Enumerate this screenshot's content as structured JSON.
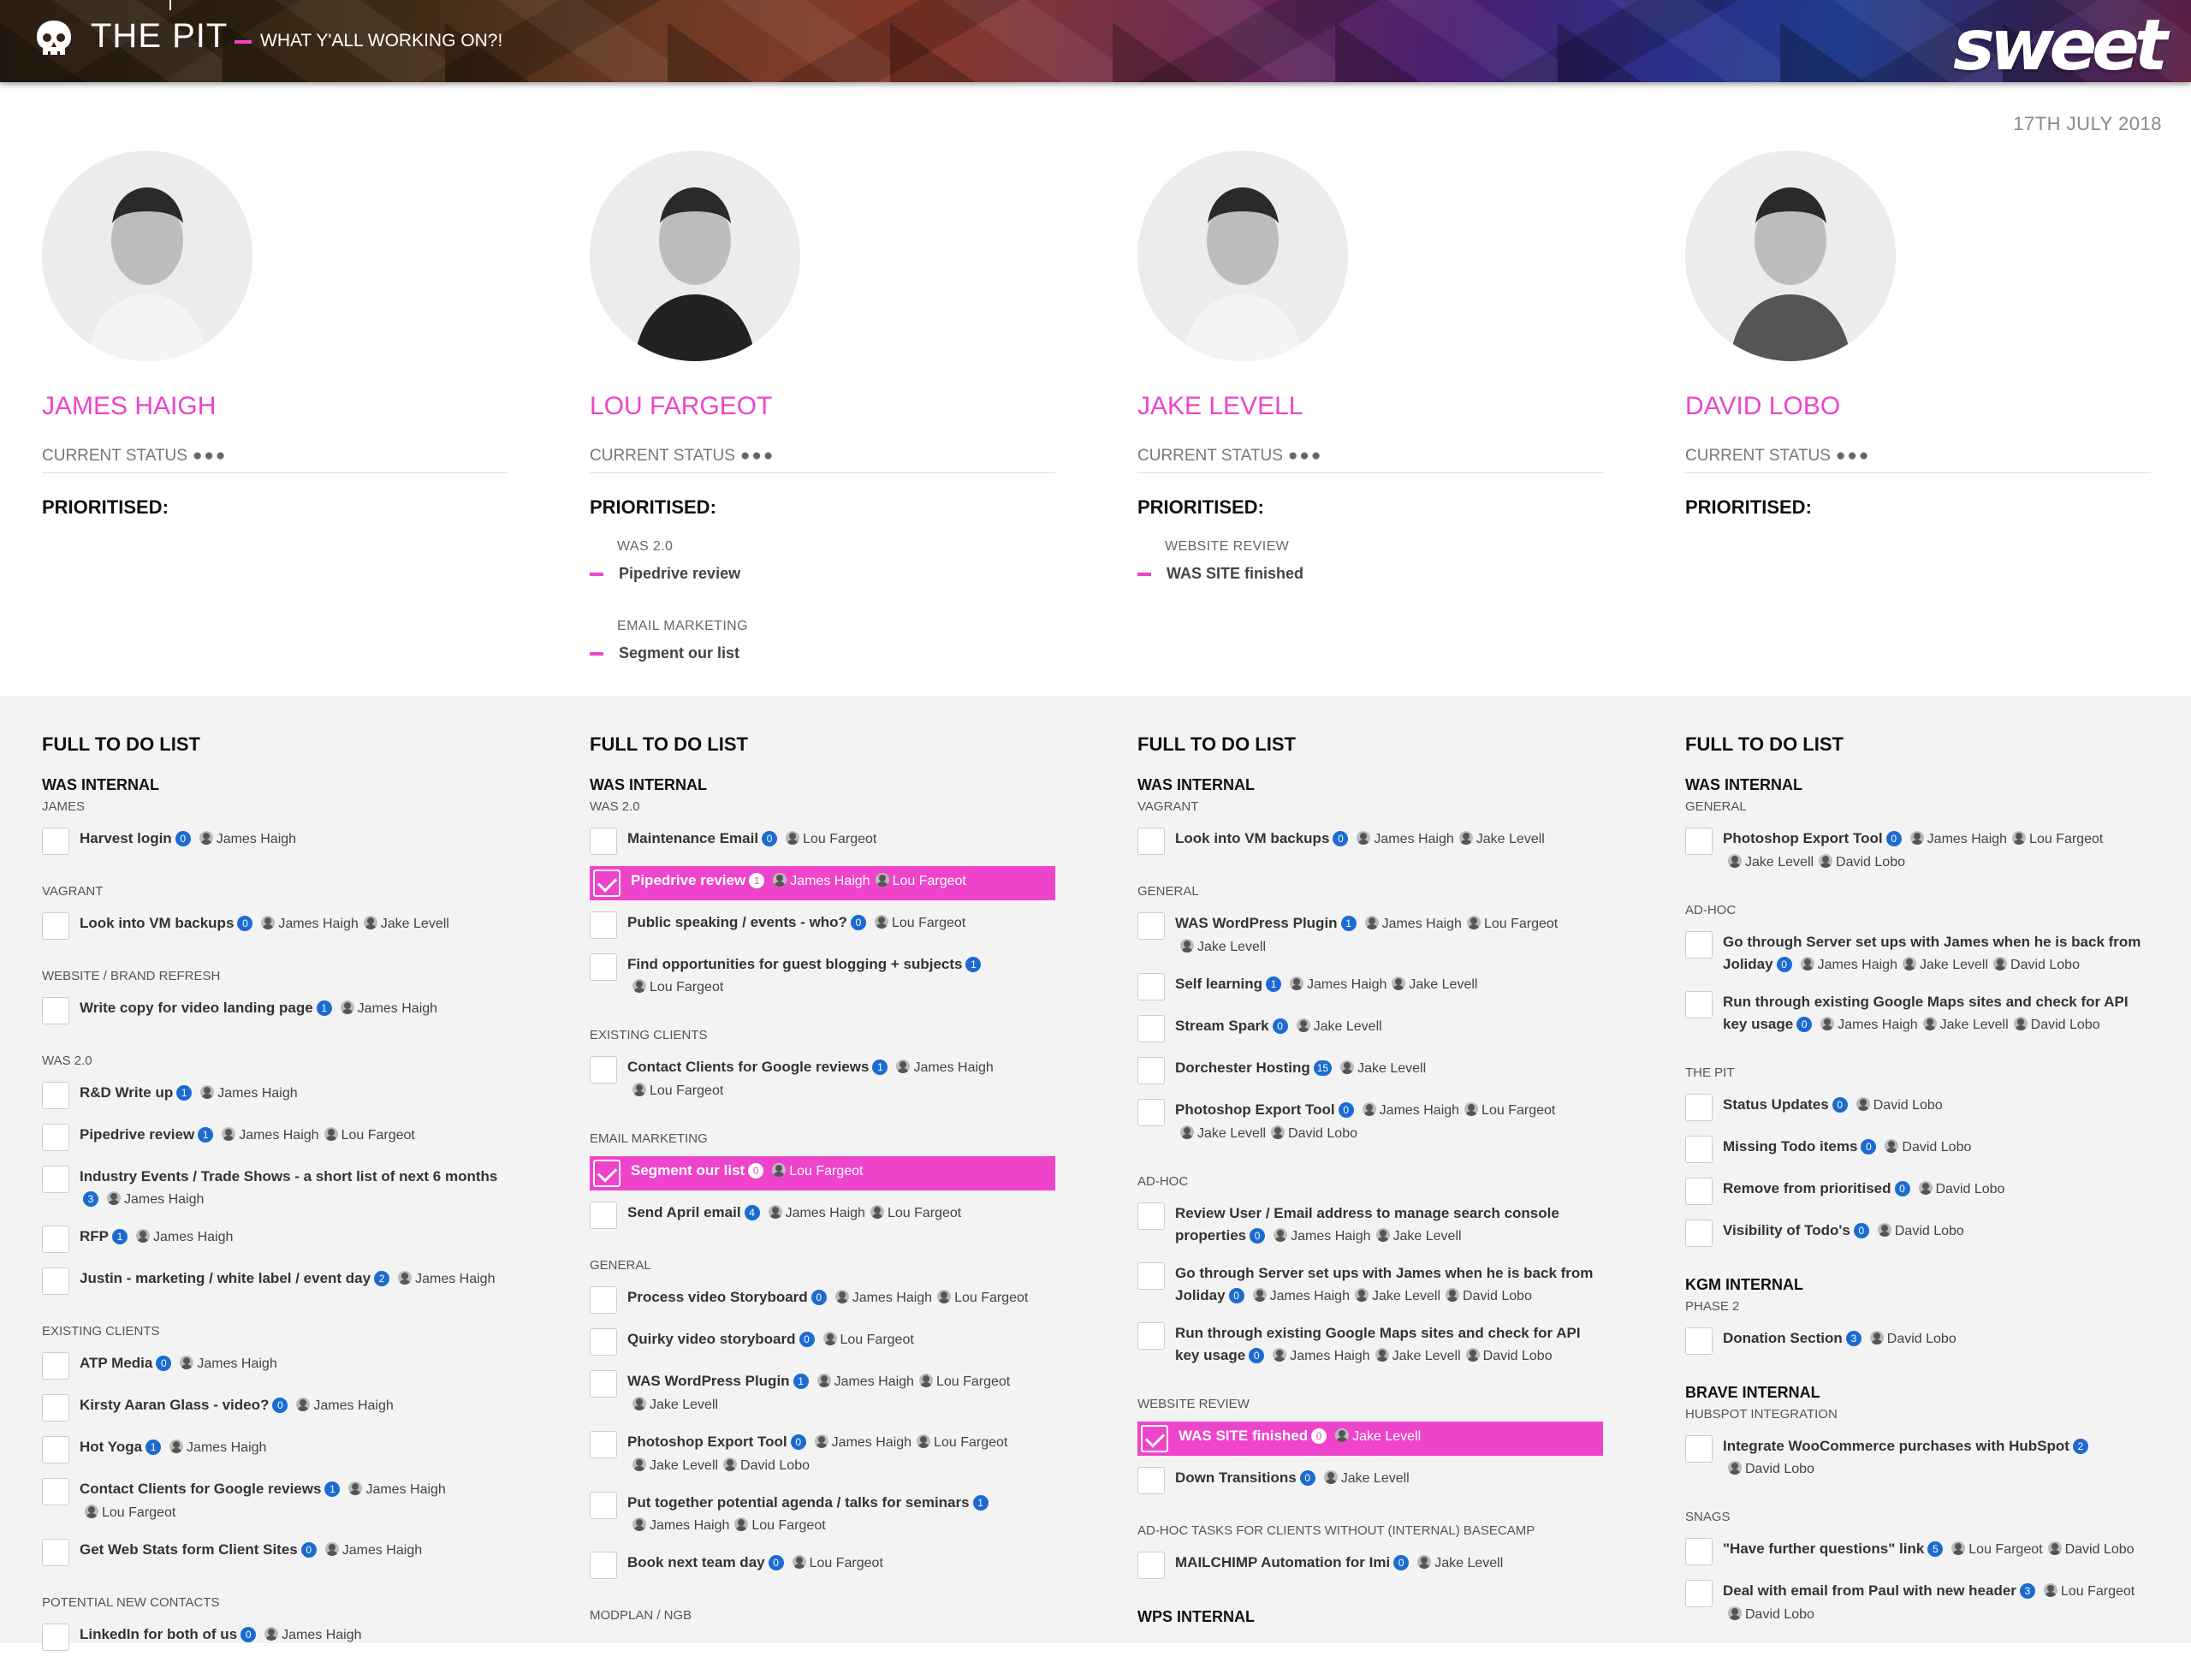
{
  "header": {
    "brand": "THE PIT",
    "tagline": "WHAT Y'ALL WORKING ON?!",
    "logo": "sweet"
  },
  "date": "17TH JULY 2018",
  "people": [
    {
      "name": "JAMES HAIGH",
      "status_label": "CURRENT STATUS",
      "status_dots": "●●●",
      "prioritised_title": "PRIORITISED:",
      "prioritised": [],
      "todo_title": "FULL TO DO LIST",
      "projects": [
        {
          "project": "WAS INTERNAL",
          "groups": [
            {
              "label": "JAMES",
              "tasks": [
                {
                  "name": "Harvest login",
                  "count": "0",
                  "assignees": [
                    "James Haigh"
                  ]
                }
              ]
            },
            {
              "label": "VAGRANT",
              "tasks": [
                {
                  "name": "Look into VM backups",
                  "count": "0",
                  "assignees": [
                    "James Haigh",
                    "Jake Levell"
                  ]
                }
              ]
            },
            {
              "label": "WEBSITE / BRAND REFRESH",
              "tasks": [
                {
                  "name": "Write copy for video landing page",
                  "count": "1",
                  "assignees": [
                    "James Haigh"
                  ]
                }
              ]
            },
            {
              "label": "WAS 2.0",
              "tasks": [
                {
                  "name": "R&D Write up",
                  "count": "1",
                  "assignees": [
                    "James Haigh"
                  ]
                },
                {
                  "name": "Pipedrive review",
                  "count": "1",
                  "assignees": [
                    "James Haigh",
                    "Lou Fargeot"
                  ]
                },
                {
                  "name": "Industry Events / Trade Shows - a short list of next 6 months",
                  "count": "3",
                  "assignees": [
                    "James Haigh"
                  ]
                },
                {
                  "name": "RFP",
                  "count": "1",
                  "assignees": [
                    "James Haigh"
                  ]
                },
                {
                  "name": "Justin - marketing / white label / event day",
                  "count": "2",
                  "assignees": [
                    "James Haigh"
                  ]
                }
              ]
            },
            {
              "label": "EXISTING CLIENTS",
              "tasks": [
                {
                  "name": "ATP Media",
                  "count": "0",
                  "assignees": [
                    "James Haigh"
                  ]
                },
                {
                  "name": "Kirsty Aaran Glass - video?",
                  "count": "0",
                  "assignees": [
                    "James Haigh"
                  ]
                },
                {
                  "name": "Hot Yoga",
                  "count": "1",
                  "assignees": [
                    "James Haigh"
                  ]
                },
                {
                  "name": "Contact Clients for Google reviews",
                  "count": "1",
                  "assignees": [
                    "James Haigh",
                    "Lou Fargeot"
                  ]
                },
                {
                  "name": "Get Web Stats form Client Sites",
                  "count": "0",
                  "assignees": [
                    "James Haigh"
                  ]
                }
              ]
            },
            {
              "label": "POTENTIAL NEW CONTACTS",
              "tasks": [
                {
                  "name": "LinkedIn for both of us",
                  "count": "0",
                  "assignees": [
                    "James Haigh"
                  ]
                }
              ]
            }
          ]
        }
      ]
    },
    {
      "name": "LOU FARGEOT",
      "status_label": "CURRENT STATUS",
      "status_dots": "●●●",
      "prioritised_title": "PRIORITISED:",
      "prioritised": [
        {
          "category": "WAS 2.0",
          "task": "Pipedrive review"
        },
        {
          "category": "EMAIL MARKETING",
          "task": "Segment our list"
        }
      ],
      "todo_title": "FULL TO DO LIST",
      "projects": [
        {
          "project": "WAS INTERNAL",
          "groups": [
            {
              "label": "WAS 2.0",
              "tasks": [
                {
                  "name": "Maintenance Email",
                  "count": "0",
                  "assignees": [
                    "Lou Fargeot"
                  ]
                },
                {
                  "name": "Pipedrive review",
                  "count": "1",
                  "assignees": [
                    "James Haigh",
                    "Lou Fargeot"
                  ],
                  "done": true
                },
                {
                  "name": "Public speaking / events - who?",
                  "count": "0",
                  "assignees": [
                    "Lou Fargeot"
                  ]
                },
                {
                  "name": "Find opportunities for guest blogging + subjects",
                  "count": "1",
                  "assignees": [
                    "Lou Fargeot"
                  ]
                }
              ]
            },
            {
              "label": "EXISTING CLIENTS",
              "tasks": [
                {
                  "name": "Contact Clients for Google reviews",
                  "count": "1",
                  "assignees": [
                    "James Haigh",
                    "Lou Fargeot"
                  ]
                }
              ]
            },
            {
              "label": "EMAIL MARKETING",
              "tasks": [
                {
                  "name": "Segment our list",
                  "count": "0",
                  "assignees": [
                    "Lou Fargeot"
                  ],
                  "done": true
                },
                {
                  "name": "Send April email",
                  "count": "4",
                  "assignees": [
                    "James Haigh",
                    "Lou Fargeot"
                  ]
                }
              ]
            },
            {
              "label": "GENERAL",
              "tasks": [
                {
                  "name": "Process video Storyboard",
                  "count": "0",
                  "assignees": [
                    "James Haigh",
                    "Lou Fargeot"
                  ]
                },
                {
                  "name": "Quirky video storyboard",
                  "count": "0",
                  "assignees": [
                    "Lou Fargeot"
                  ]
                },
                {
                  "name": "WAS WordPress Plugin",
                  "count": "1",
                  "assignees": [
                    "James Haigh",
                    "Lou Fargeot",
                    "Jake Levell"
                  ]
                },
                {
                  "name": "Photoshop Export Tool",
                  "count": "0",
                  "assignees": [
                    "James Haigh",
                    "Lou Fargeot",
                    "Jake Levell",
                    "David Lobo"
                  ]
                },
                {
                  "name": "Put together potential agenda / talks for seminars",
                  "count": "1",
                  "assignees": [
                    "James Haigh",
                    "Lou Fargeot"
                  ]
                },
                {
                  "name": "Book next team day",
                  "count": "0",
                  "assignees": [
                    "Lou Fargeot"
                  ]
                }
              ]
            },
            {
              "label": "MODPLAN / NGB",
              "tasks": []
            }
          ]
        }
      ]
    },
    {
      "name": "JAKE LEVELL",
      "status_label": "CURRENT STATUS",
      "status_dots": "●●●",
      "prioritised_title": "PRIORITISED:",
      "prioritised": [
        {
          "category": "WEBSITE REVIEW",
          "task": "WAS SITE finished"
        }
      ],
      "todo_title": "FULL TO DO LIST",
      "projects": [
        {
          "project": "WAS INTERNAL",
          "groups": [
            {
              "label": "VAGRANT",
              "tasks": [
                {
                  "name": "Look into VM backups",
                  "count": "0",
                  "assignees": [
                    "James Haigh",
                    "Jake Levell"
                  ]
                }
              ]
            },
            {
              "label": "GENERAL",
              "tasks": [
                {
                  "name": "WAS WordPress Plugin",
                  "count": "1",
                  "assignees": [
                    "James Haigh",
                    "Lou Fargeot",
                    "Jake Levell"
                  ]
                },
                {
                  "name": "Self learning",
                  "count": "1",
                  "assignees": [
                    "James Haigh",
                    "Jake Levell"
                  ]
                },
                {
                  "name": "Stream Spark",
                  "count": "0",
                  "assignees": [
                    "Jake Levell"
                  ]
                },
                {
                  "name": "Dorchester Hosting",
                  "count": "15",
                  "assignees": [
                    "Jake Levell"
                  ]
                },
                {
                  "name": "Photoshop Export Tool",
                  "count": "0",
                  "assignees": [
                    "James Haigh",
                    "Lou Fargeot",
                    "Jake Levell",
                    "David Lobo"
                  ]
                }
              ]
            },
            {
              "label": "AD-HOC",
              "tasks": [
                {
                  "name": "Review User / Email address to manage search console properties",
                  "count": "0",
                  "assignees": [
                    "James Haigh",
                    "Jake Levell"
                  ]
                },
                {
                  "name": "Go through Server set ups with James when he is back from Joliday",
                  "count": "0",
                  "assignees": [
                    "James Haigh",
                    "Jake Levell",
                    "David Lobo"
                  ]
                },
                {
                  "name": "Run through existing Google Maps sites and check for API key usage",
                  "count": "0",
                  "assignees": [
                    "James Haigh",
                    "Jake Levell",
                    "David Lobo"
                  ]
                }
              ]
            },
            {
              "label": "WEBSITE REVIEW",
              "tasks": [
                {
                  "name": "WAS SITE finished",
                  "count": "0",
                  "assignees": [
                    "Jake Levell"
                  ],
                  "done": true
                },
                {
                  "name": "Down Transitions",
                  "count": "0",
                  "assignees": [
                    "Jake Levell"
                  ]
                }
              ]
            },
            {
              "label": "AD-HOC TASKS FOR CLIENTS WITHOUT (INTERNAL) BASECAMP",
              "tasks": [
                {
                  "name": "MAILCHIMP Automation for Imi",
                  "count": "0",
                  "assignees": [
                    "Jake Levell"
                  ]
                }
              ]
            }
          ]
        },
        {
          "project": "WPS INTERNAL",
          "groups": []
        }
      ]
    },
    {
      "name": "DAVID LOBO",
      "status_label": "CURRENT STATUS",
      "status_dots": "●●●",
      "prioritised_title": "PRIORITISED:",
      "prioritised": [],
      "todo_title": "FULL TO DO LIST",
      "projects": [
        {
          "project": "WAS INTERNAL",
          "groups": [
            {
              "label": "GENERAL",
              "tasks": [
                {
                  "name": "Photoshop Export Tool",
                  "count": "0",
                  "assignees": [
                    "James Haigh",
                    "Lou Fargeot",
                    "Jake Levell",
                    "David Lobo"
                  ]
                }
              ]
            },
            {
              "label": "AD-HOC",
              "tasks": [
                {
                  "name": "Go through Server set ups with James when he is back from Joliday",
                  "count": "0",
                  "assignees": [
                    "James Haigh",
                    "Jake Levell",
                    "David Lobo"
                  ]
                },
                {
                  "name": "Run through existing Google Maps sites and check for API key usage",
                  "count": "0",
                  "assignees": [
                    "James Haigh",
                    "Jake Levell",
                    "David Lobo"
                  ]
                }
              ]
            },
            {
              "label": "THE PIT",
              "tasks": [
                {
                  "name": "Status Updates",
                  "count": "0",
                  "assignees": [
                    "David Lobo"
                  ]
                },
                {
                  "name": "Missing Todo items",
                  "count": "0",
                  "assignees": [
                    "David Lobo"
                  ]
                },
                {
                  "name": "Remove from prioritised",
                  "count": "0",
                  "assignees": [
                    "David Lobo"
                  ]
                },
                {
                  "name": "Visibility of Todo's",
                  "count": "0",
                  "assignees": [
                    "David Lobo"
                  ]
                }
              ]
            }
          ]
        },
        {
          "project": "KGM INTERNAL",
          "groups": [
            {
              "label": "PHASE 2",
              "tasks": [
                {
                  "name": "Donation Section",
                  "count": "3",
                  "assignees": [
                    "David Lobo"
                  ]
                }
              ]
            }
          ]
        },
        {
          "project": "BRAVE INTERNAL",
          "groups": [
            {
              "label": "HUBSPOT INTEGRATION",
              "tasks": [
                {
                  "name": "Integrate WooCommerce purchases with HubSpot",
                  "count": "2",
                  "assignees": [
                    "David Lobo"
                  ]
                }
              ]
            },
            {
              "label": "SNAGS",
              "tasks": [
                {
                  "name": "\"Have further questions\" link",
                  "count": "5",
                  "assignees": [
                    "Lou Fargeot",
                    "David Lobo"
                  ]
                },
                {
                  "name": "Deal with email from Paul with new header",
                  "count": "3",
                  "assignees": [
                    "Lou Fargeot",
                    "David Lobo"
                  ]
                }
              ]
            }
          ]
        }
      ]
    }
  ]
}
